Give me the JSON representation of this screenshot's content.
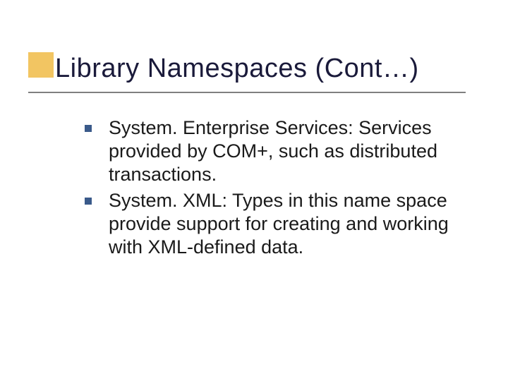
{
  "title": "Library Namespaces (Cont…)",
  "bullets": [
    "System. Enterprise Services: Services provided by COM+, such as distributed transactions.",
    "System. XML: Types in this name space provide support for creating and working with XML-defined data."
  ]
}
